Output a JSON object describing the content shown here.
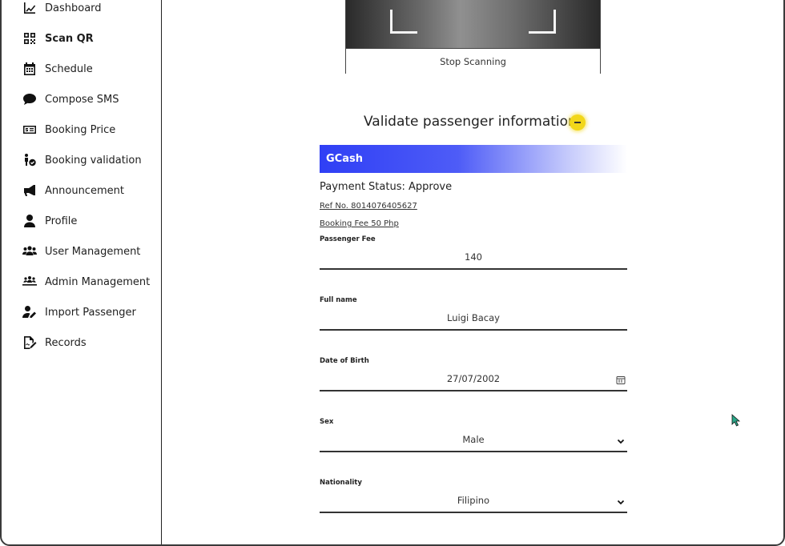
{
  "sidebar": {
    "items": [
      {
        "label": "Dashboard",
        "icon": "chart-line-icon"
      },
      {
        "label": "Scan QR",
        "icon": "qr-code-icon"
      },
      {
        "label": "Schedule",
        "icon": "calendar-icon"
      },
      {
        "label": "Compose SMS",
        "icon": "chat-bubble-icon"
      },
      {
        "label": "Booking Price",
        "icon": "money-bill-icon"
      },
      {
        "label": "Booking validation",
        "icon": "person-check-icon"
      },
      {
        "label": "Announcement",
        "icon": "megaphone-icon"
      },
      {
        "label": "Profile",
        "icon": "user-icon"
      },
      {
        "label": "User Management",
        "icon": "users-icon"
      },
      {
        "label": "Admin Management",
        "icon": "people-group-icon"
      },
      {
        "label": "Import Passenger",
        "icon": "user-edit-icon"
      },
      {
        "label": "Records",
        "icon": "file-signature-icon"
      }
    ],
    "active": "Scan QR"
  },
  "scanner": {
    "stop_label": "Stop Scanning"
  },
  "validation": {
    "title": "Validate passenger information",
    "payment_method": "GCash",
    "payment_status": "Payment Status: Approve",
    "ref_no": "Ref No. 8014076405627",
    "booking_fee": "Booking Fee 50 Php",
    "accent_color": "#2f3ff5",
    "badge_color": "#f2d71a"
  },
  "fields": {
    "passenger_fee": {
      "label": "Passenger Fee",
      "value": "140"
    },
    "full_name": {
      "label": "Full name",
      "value": "Luigi Bacay"
    },
    "date_of_birth": {
      "label": "Date of Birth",
      "value": "27/07/2002",
      "icon": "calendar-icon"
    },
    "sex": {
      "label": "Sex",
      "value": "Male",
      "icon": "chevron-down-icon"
    },
    "nationality": {
      "label": "Nationality",
      "value": "Filipino",
      "icon": "chevron-down-icon"
    }
  }
}
